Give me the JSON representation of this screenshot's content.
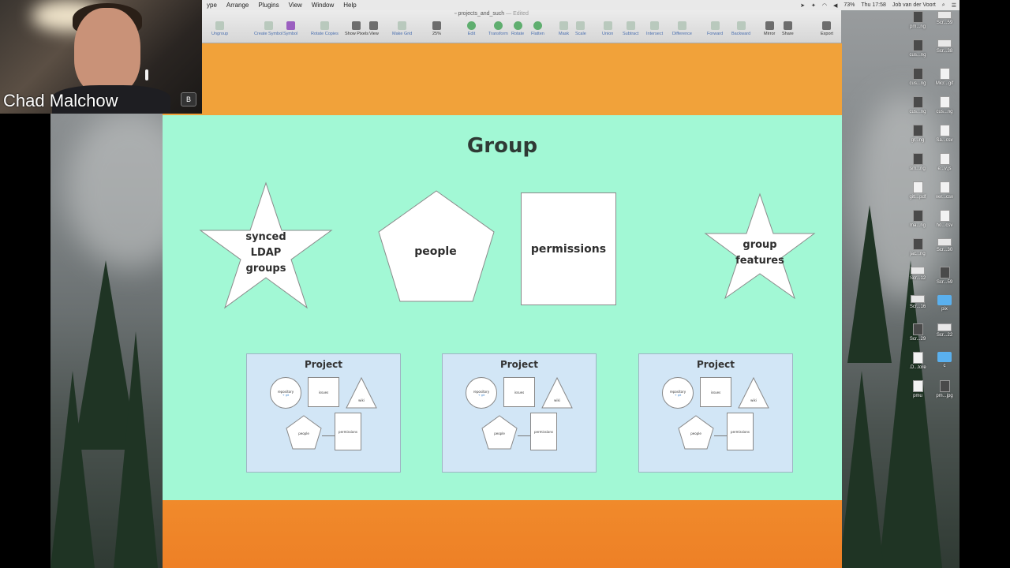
{
  "menubar": {
    "menus": [
      "ype",
      "Arrange",
      "Plugins",
      "View",
      "Window",
      "Help"
    ],
    "battery": "73%",
    "clock": "Thu 17:58",
    "user": "Job van der Voort"
  },
  "document": {
    "name": "projects_and_such",
    "status": "— Edited"
  },
  "toolbar": {
    "items": [
      {
        "label": "Ungroup",
        "style": "light"
      },
      {
        "label": "Create Symbol",
        "style": "light"
      },
      {
        "label": "Symbol",
        "style": "purple"
      },
      {
        "label": "Rotate Copies",
        "style": "light"
      },
      {
        "label": "Show Pixels",
        "style": "dark"
      },
      {
        "label": "View",
        "style": "dark"
      },
      {
        "label": "Make Grid",
        "style": "light"
      },
      {
        "label": "25%",
        "style": "dark"
      },
      {
        "label": "Edit",
        "style": "green"
      },
      {
        "label": "Transform",
        "style": "green"
      },
      {
        "label": "Rotate",
        "style": "green"
      },
      {
        "label": "Flatten",
        "style": "green"
      },
      {
        "label": "Mask",
        "style": "light"
      },
      {
        "label": "Scale",
        "style": "light"
      },
      {
        "label": "Union",
        "style": "light"
      },
      {
        "label": "Subtract",
        "style": "light"
      },
      {
        "label": "Intersect",
        "style": "light"
      },
      {
        "label": "Difference",
        "style": "light"
      },
      {
        "label": "Forward",
        "style": "light"
      },
      {
        "label": "Backward",
        "style": "light"
      },
      {
        "label": "Mirror",
        "style": "dark"
      },
      {
        "label": "Share",
        "style": "dark"
      },
      {
        "label": "Export",
        "style": "dark"
      }
    ]
  },
  "canvas": {
    "title": "Group",
    "shapes": {
      "synced_ldap": "synced LDAP groups",
      "people": "people",
      "permissions": "permissions",
      "group_features": "group features"
    },
    "projects": [
      {
        "title": "Project",
        "repository": "repository",
        "repository_sub": "+ git",
        "issues": "issues",
        "wiki": "wiki",
        "people": "people",
        "permissions": "permissions"
      },
      {
        "title": "Project",
        "repository": "repository",
        "repository_sub": "+ git",
        "issues": "issues",
        "wiki": "wiki",
        "people": "people",
        "permissions": "permissions"
      },
      {
        "title": "Project",
        "repository": "repository",
        "repository_sub": "+ git",
        "issues": "issues",
        "wiki": "wiki",
        "people": "people",
        "permissions": "permissions"
      }
    ]
  },
  "webcam": {
    "name": "Chad Malchow",
    "badge": "B"
  },
  "desktop_icons": [
    {
      "label": "pm...ng",
      "kind": "img"
    },
    {
      "label": "Scr...59",
      "kind": "wide"
    },
    {
      "label": "cus...ng",
      "kind": "img"
    },
    {
      "label": "Scr...38",
      "kind": "wide"
    },
    {
      "label": "cus...ng",
      "kind": "img"
    },
    {
      "label": "Micr...gif",
      "kind": "doc"
    },
    {
      "label": "cus...ng",
      "kind": "img"
    },
    {
      "label": "cus...ng",
      "kind": "doc"
    },
    {
      "label": "gr...ng",
      "kind": "img"
    },
    {
      "label": "Sa...csv",
      "kind": "doc"
    },
    {
      "label": "sm...ng",
      "kind": "img"
    },
    {
      "label": "e...v.js",
      "kind": "doc"
    },
    {
      "label": "gitl...pdf",
      "kind": "doc"
    },
    {
      "label": "ver...csv",
      "kind": "doc"
    },
    {
      "label": "ma...ng",
      "kind": "img"
    },
    {
      "label": "ho...csv",
      "kind": "doc"
    },
    {
      "label": "jac...ng",
      "kind": "img"
    },
    {
      "label": "Scr...30",
      "kind": "wide"
    },
    {
      "label": "Scr...12",
      "kind": "wide"
    },
    {
      "label": "Scr...59",
      "kind": "img"
    },
    {
      "label": "Scr...16",
      "kind": "wide"
    },
    {
      "label": "pix",
      "kind": "folder"
    },
    {
      "label": "Scr...29",
      "kind": "img"
    },
    {
      "label": "Scr...22",
      "kind": "wide"
    },
    {
      "label": ".D...tore",
      "kind": "doc"
    },
    {
      "label": "c",
      "kind": "folder"
    },
    {
      "label": "pmu",
      "kind": "doc"
    },
    {
      "label": "pm...jpg",
      "kind": "img"
    }
  ]
}
